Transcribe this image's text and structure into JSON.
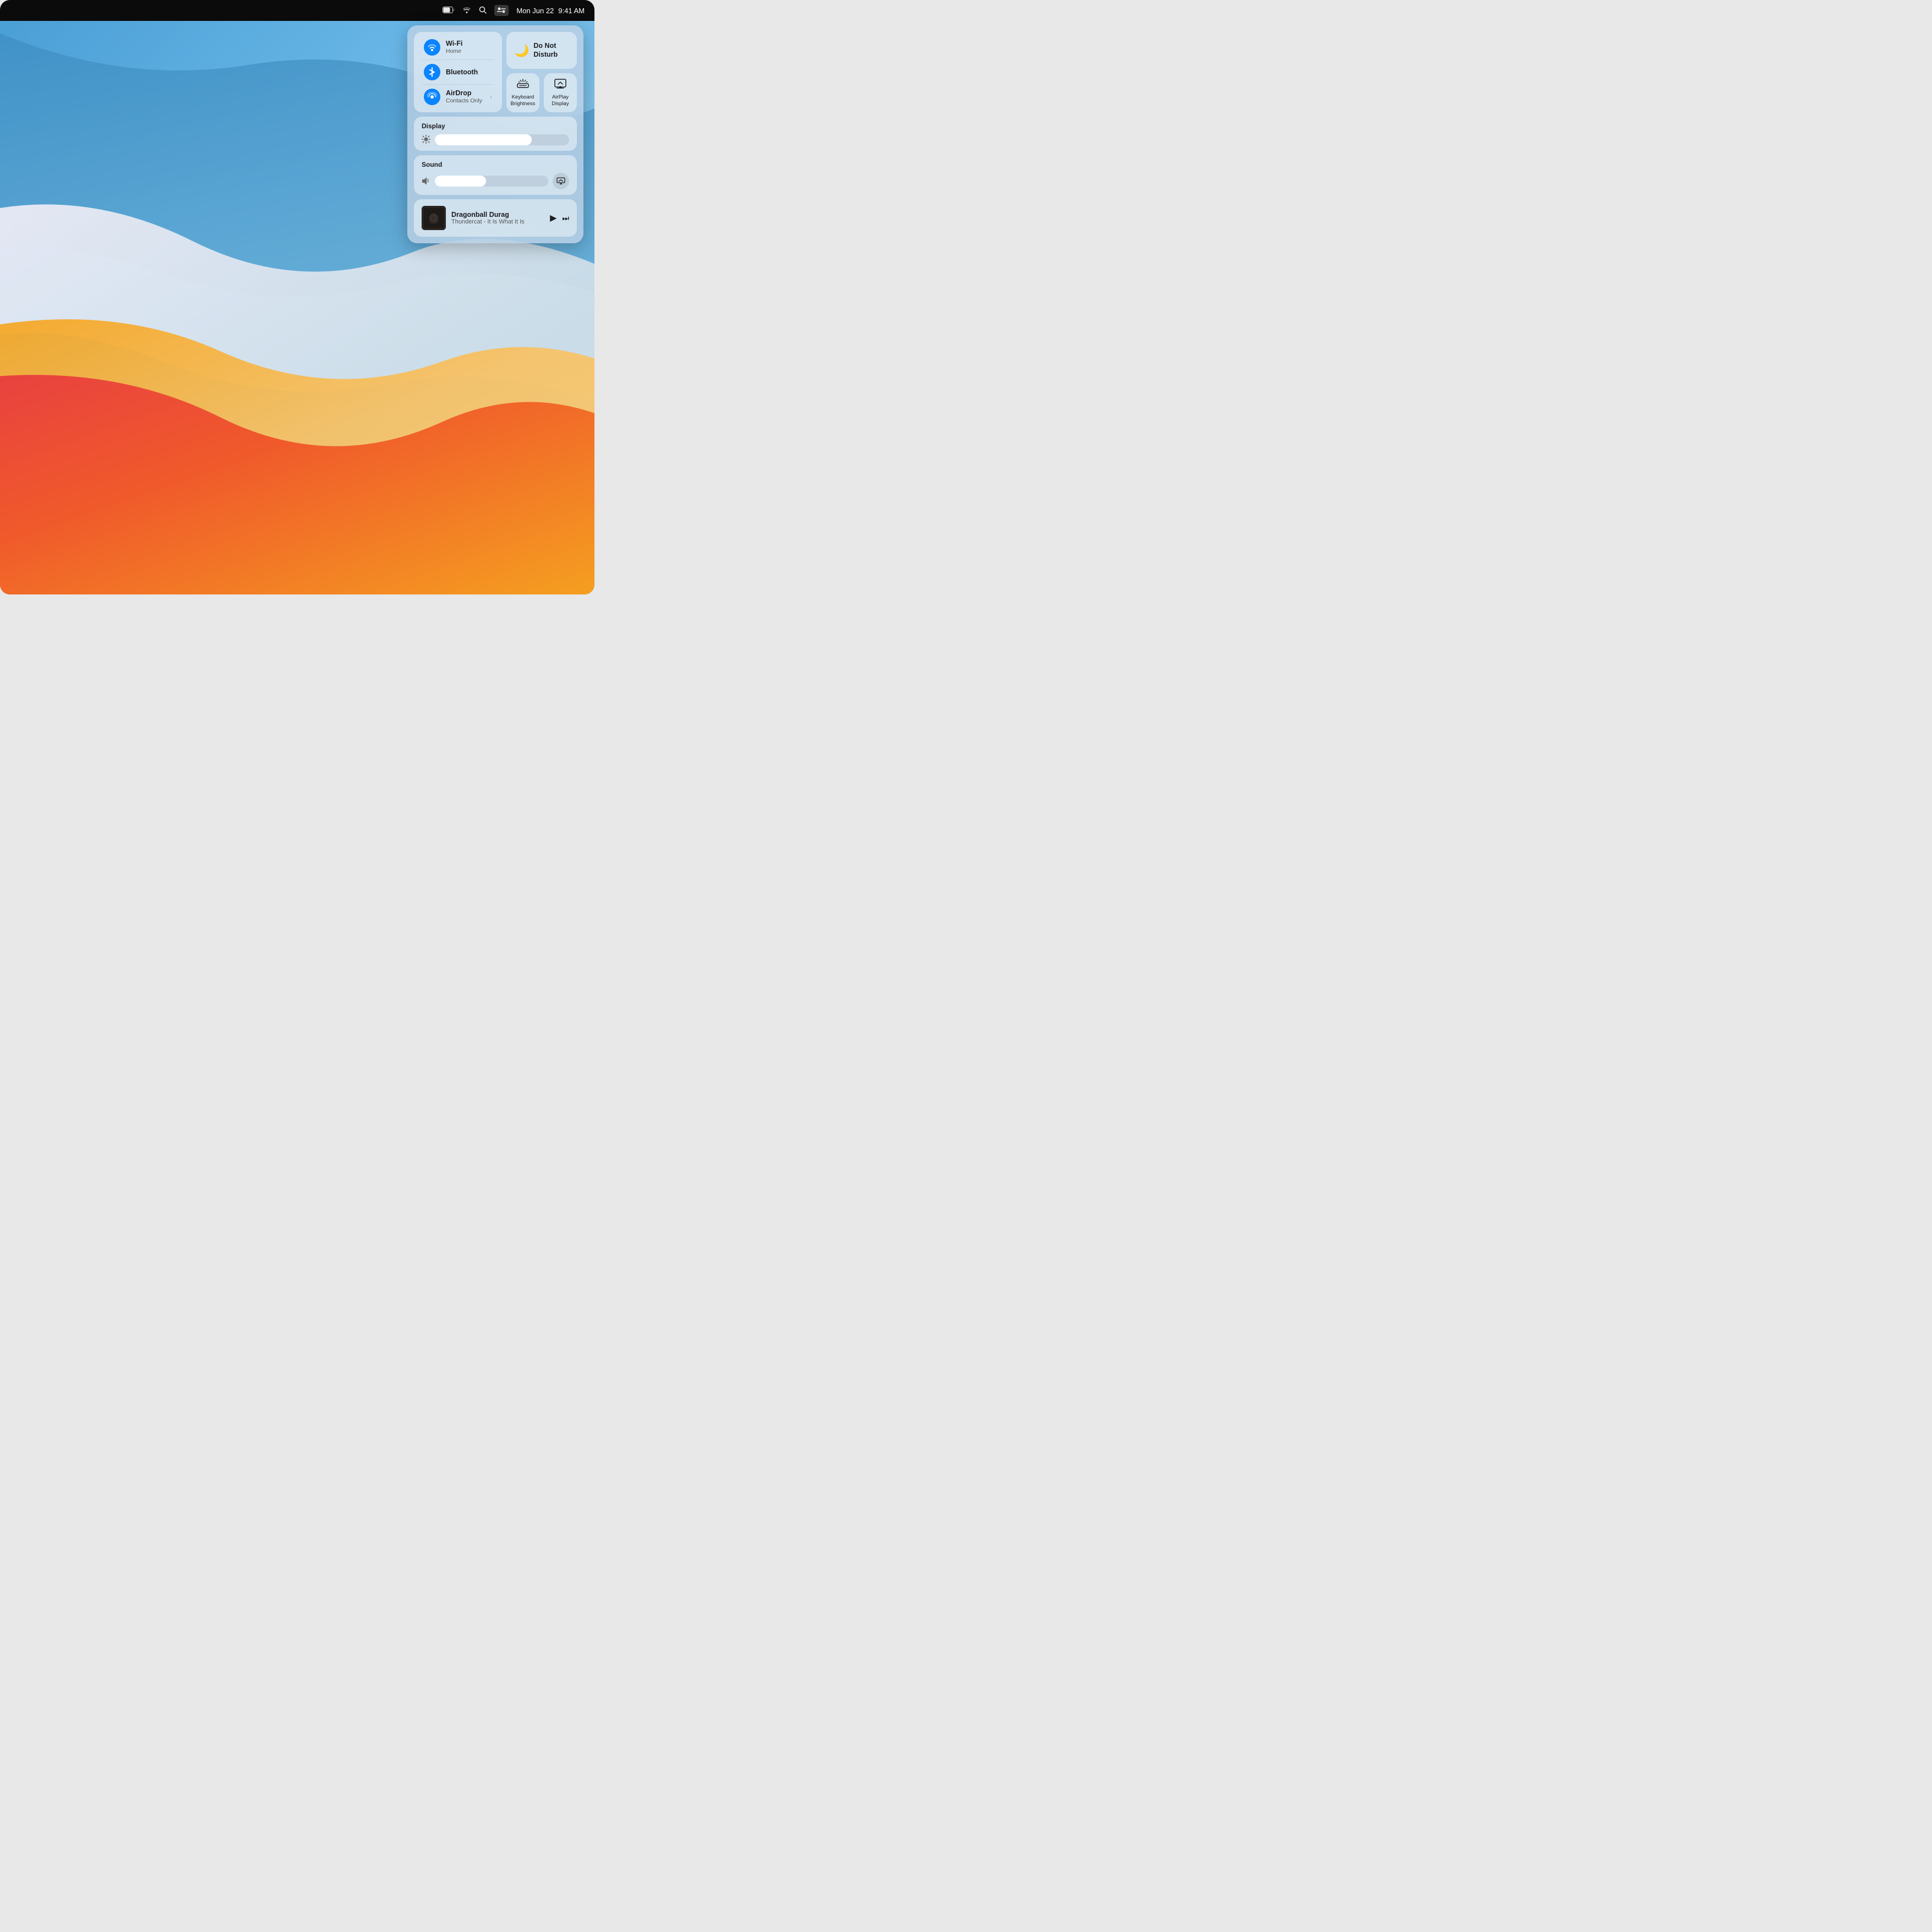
{
  "menubar": {
    "date": "Mon Jun 22",
    "time": "9:41 AM"
  },
  "control_center": {
    "wifi": {
      "title": "Wi-Fi",
      "subtitle": "Home",
      "active": true
    },
    "bluetooth": {
      "title": "Bluetooth",
      "subtitle": "",
      "active": true
    },
    "airdrop": {
      "title": "AirDrop",
      "subtitle": "Contacts Only",
      "active": true
    },
    "dnd": {
      "title": "Do Not\nDisturb",
      "active": false
    },
    "keyboard_brightness": {
      "label": "Keyboard\nBrightness"
    },
    "airplay_display": {
      "label": "AirPlay\nDisplay"
    },
    "display": {
      "label": "Display",
      "brightness_pct": "72%"
    },
    "sound": {
      "label": "Sound",
      "volume_pct": "45%"
    },
    "nowplaying": {
      "track": "Dragonball Durag",
      "artist_album": "Thundercat - It Is What It Is"
    }
  }
}
